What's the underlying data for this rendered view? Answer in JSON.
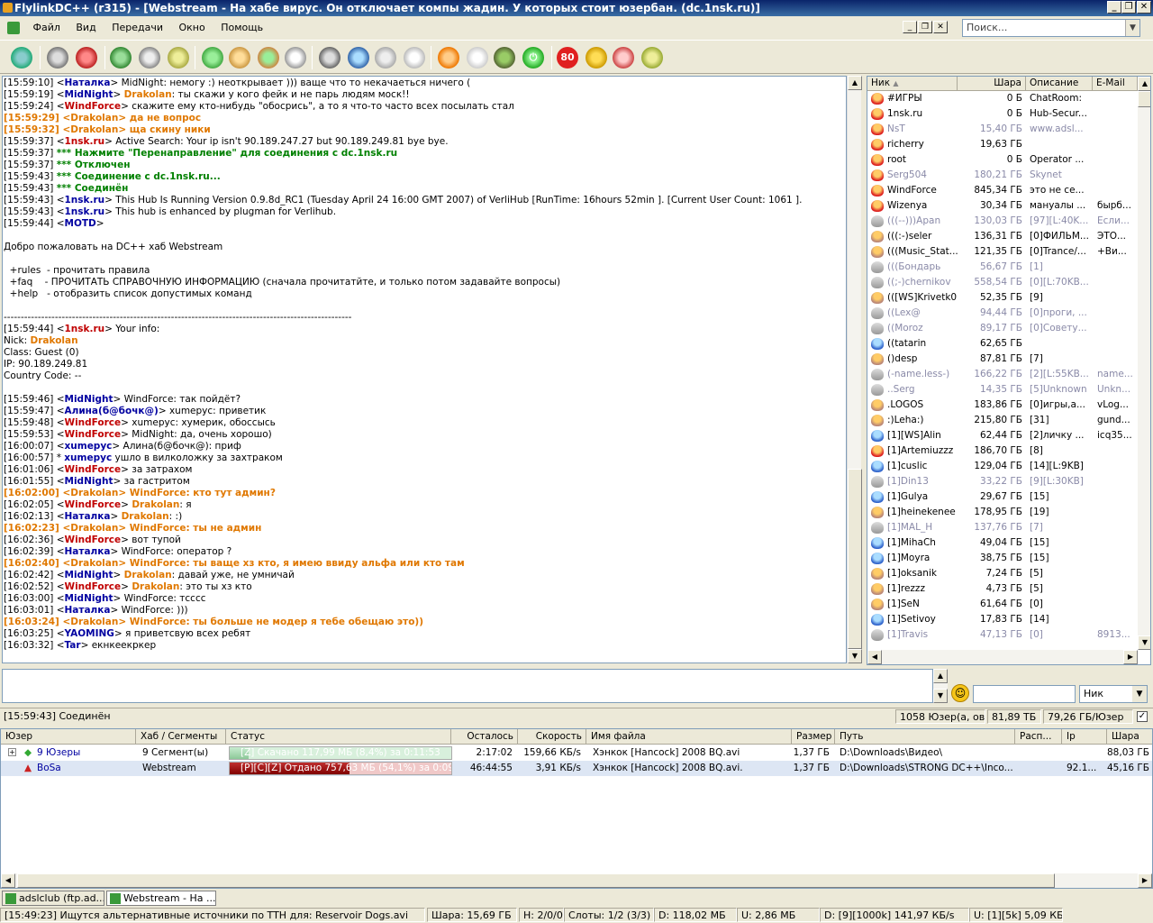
{
  "title": "FlylinkDC++ (r315) - [Webstream - На хабе вирус. Он отключает компы жадин. У которых стоит юзербан. (dc.1nsk.ru)]",
  "menu": [
    "Файл",
    "Вид",
    "Передачи",
    "Окно",
    "Помощь"
  ],
  "search_placeholder": "Поиск...",
  "toolbar_badge": "80",
  "chat": [
    [
      [
        "t",
        "[15:59:10] <"
      ],
      [
        "k",
        "Наталка"
      ],
      [
        "t",
        "> MidNight: немогу :) неоткрывает ))) ваще что то некачаеться ничего ("
      ]
    ],
    [
      [
        "t",
        "[15:59:19] <"
      ],
      [
        "k",
        "MidNight"
      ],
      [
        "t",
        "> "
      ],
      [
        "o",
        "Drakolan"
      ],
      [
        "t",
        ": ты скажи у кого фейк и не парь людям моск!!"
      ]
    ],
    [
      [
        "t",
        "[15:59:24] <"
      ],
      [
        "r",
        "WindForce"
      ],
      [
        "t",
        "> скажите ему кто-нибудь \"обосрись\", а то я что-то часто всех посылать стал"
      ]
    ],
    [
      [
        "m",
        "[15:59:29] <Drakolan> да не вопрос"
      ]
    ],
    [
      [
        "m",
        "[15:59:32] <Drakolan> ща скину ники"
      ]
    ],
    [
      [
        "t",
        "[15:59:37] <"
      ],
      [
        "r",
        "1nsk.ru"
      ],
      [
        "t",
        "> Active Search: Your ip isn't 90.189.247.27 but 90.189.249.81 bye bye."
      ]
    ],
    [
      [
        "t",
        "[15:59:37] "
      ],
      [
        "g",
        "*** Нажмите \"Перенаправление\" для соединения с dc.1nsk.ru"
      ]
    ],
    [
      [
        "t",
        "[15:59:37] "
      ],
      [
        "g",
        "*** Отключен"
      ]
    ],
    [
      [
        "t",
        "[15:59:43] "
      ],
      [
        "g",
        "*** Соединение с dc.1nsk.ru..."
      ]
    ],
    [
      [
        "t",
        "[15:59:43] "
      ],
      [
        "g",
        "*** Соединён"
      ]
    ],
    [
      [
        "t",
        "[15:59:43] <"
      ],
      [
        "k",
        "1nsk.ru"
      ],
      [
        "t",
        "> This Hub Is Running Version 0.9.8d_RC1 (Tuesday April 24 16:00 GMT 2007) of VerliHub [RunTime: 16hours 52min ]. [Current User Count: 1061 ]."
      ]
    ],
    [
      [
        "t",
        "[15:59:43] <"
      ],
      [
        "k",
        "1nsk.ru"
      ],
      [
        "t",
        "> This hub is enhanced by plugman for Verlihub."
      ]
    ],
    [
      [
        "t",
        "[15:59:44] <"
      ],
      [
        "k",
        "MOTD"
      ],
      [
        "t",
        ">"
      ]
    ],
    [
      [
        "t",
        ""
      ]
    ],
    [
      [
        "t",
        "Добро пожаловать на DC++ хаб Webstream"
      ]
    ],
    [
      [
        "t",
        ""
      ]
    ],
    [
      [
        "t",
        "  +rules  - прочитать правила"
      ]
    ],
    [
      [
        "t",
        "  +faq    - ПРОЧИТАТЬ СПРАВОЧНУЮ ИНФОРМАЦИЮ (сначала прочитатйте, и только потом задавайте вопросы)"
      ]
    ],
    [
      [
        "t",
        "  +help   - отобразить список допустимых команд"
      ]
    ],
    [
      [
        "t",
        ""
      ]
    ],
    [
      [
        "t",
        "------------------------------------------------------------------------------------------------------"
      ]
    ],
    [
      [
        "t",
        "[15:59:44] <"
      ],
      [
        "r",
        "1nsk.ru"
      ],
      [
        "t",
        "> Your info:"
      ]
    ],
    [
      [
        "t",
        "Nick: "
      ],
      [
        "o",
        "Drakolan"
      ]
    ],
    [
      [
        "t",
        "Class: Guest (0)"
      ]
    ],
    [
      [
        "t",
        "IP: 90.189.249.81"
      ]
    ],
    [
      [
        "t",
        "Country Code: --"
      ]
    ],
    [
      [
        "t",
        ""
      ]
    ],
    [
      [
        "t",
        "[15:59:46] <"
      ],
      [
        "k",
        "MidNight"
      ],
      [
        "t",
        "> WindForce: так пойдёт?"
      ]
    ],
    [
      [
        "t",
        "[15:59:47] <"
      ],
      [
        "k",
        "Алина(б@бочк@)"
      ],
      [
        "t",
        "> хumерус: приветик"
      ]
    ],
    [
      [
        "t",
        "[15:59:48] <"
      ],
      [
        "r",
        "WindForce"
      ],
      [
        "t",
        "> хumерус: хумерик, обоссысь"
      ]
    ],
    [
      [
        "t",
        "[15:59:53] <"
      ],
      [
        "r",
        "WindForce"
      ],
      [
        "t",
        "> MidNight: да, очень хорошо)"
      ]
    ],
    [
      [
        "t",
        "[16:00:07] <"
      ],
      [
        "k",
        "хumерус"
      ],
      [
        "t",
        "> Алина(б@бочк@): приф"
      ]
    ],
    [
      [
        "t",
        "[16:00:57] * "
      ],
      [
        "k",
        "хumерус"
      ],
      [
        "t",
        " ушло в вилколожку за захтраком"
      ]
    ],
    [
      [
        "t",
        "[16:01:06] <"
      ],
      [
        "r",
        "WindForce"
      ],
      [
        "t",
        "> за затрахом"
      ]
    ],
    [
      [
        "t",
        "[16:01:55] <"
      ],
      [
        "k",
        "MidNight"
      ],
      [
        "t",
        "> за гастритом"
      ]
    ],
    [
      [
        "m",
        "[16:02:00] <Drakolan> WindForce: кто тут админ?"
      ]
    ],
    [
      [
        "t",
        "[16:02:05] <"
      ],
      [
        "r",
        "WindForce"
      ],
      [
        "t",
        "> "
      ],
      [
        "o",
        "Drakolan"
      ],
      [
        "t",
        ": я"
      ]
    ],
    [
      [
        "t",
        "[16:02:13] <"
      ],
      [
        "k",
        "Наталка"
      ],
      [
        "t",
        "> "
      ],
      [
        "o",
        "Drakolan"
      ],
      [
        "t",
        ": :)"
      ]
    ],
    [
      [
        "m",
        "[16:02:23] <Drakolan> WindForce: ты не админ"
      ]
    ],
    [
      [
        "t",
        "[16:02:36] <"
      ],
      [
        "r",
        "WindForce"
      ],
      [
        "t",
        "> вот тупой"
      ]
    ],
    [
      [
        "t",
        "[16:02:39] <"
      ],
      [
        "k",
        "Наталка"
      ],
      [
        "t",
        "> WindForce: оператор ?"
      ]
    ],
    [
      [
        "m",
        "[16:02:40] <Drakolan> WindForce: ты ваще хз кто, я имею ввиду альфа или кто там"
      ]
    ],
    [
      [
        "t",
        "[16:02:42] <"
      ],
      [
        "k",
        "MidNight"
      ],
      [
        "t",
        "> "
      ],
      [
        "o",
        "Drakolan"
      ],
      [
        "t",
        ": давай уже, не умничай"
      ]
    ],
    [
      [
        "t",
        "[16:02:52] <"
      ],
      [
        "r",
        "WindForce"
      ],
      [
        "t",
        "> "
      ],
      [
        "o",
        "Drakolan"
      ],
      [
        "t",
        ": это ты хз кто"
      ]
    ],
    [
      [
        "t",
        "[16:03:00] <"
      ],
      [
        "k",
        "MidNight"
      ],
      [
        "t",
        "> WindForce: тсссс"
      ]
    ],
    [
      [
        "t",
        "[16:03:01] <"
      ],
      [
        "k",
        "Наталка"
      ],
      [
        "t",
        "> WindForce: )))"
      ]
    ],
    [
      [
        "m",
        "[16:03:24] <Drakolan> WindForce: ты больше не модер я тебе обещаю это))"
      ]
    ],
    [
      [
        "t",
        "[16:03:25] <"
      ],
      [
        "k",
        "YAOMING"
      ],
      [
        "t",
        "> я приветсвую всех ребят"
      ]
    ],
    [
      [
        "t",
        "[16:03:32] <"
      ],
      [
        "k",
        "Tar"
      ],
      [
        "t",
        "> екнкеекркер"
      ]
    ]
  ],
  "users_header": {
    "nick": "Ник",
    "share": "Шара",
    "desc": "Описание",
    "email": "E-Mail"
  },
  "users": [
    {
      "nick": "#ИГРЫ",
      "share": "0 Б",
      "desc": "ChatRoom:",
      "email": "",
      "grey": false,
      "icon": "op"
    },
    {
      "nick": "1nsk.ru",
      "share": "0 Б",
      "desc": "Hub-Secur...",
      "email": "",
      "grey": false,
      "icon": "op"
    },
    {
      "nick": "NsT",
      "share": "15,40 ГБ",
      "desc": "www.adsl...",
      "email": "",
      "grey": true,
      "icon": "op"
    },
    {
      "nick": "richerry",
      "share": "19,63 ГБ",
      "desc": "",
      "email": "",
      "grey": false,
      "icon": "op"
    },
    {
      "nick": "root",
      "share": "0 Б",
      "desc": "Operator ...",
      "email": "",
      "grey": false,
      "icon": "op"
    },
    {
      "nick": "Serg504",
      "share": "180,21 ГБ",
      "desc": "Skynet",
      "email": "",
      "grey": true,
      "icon": "op"
    },
    {
      "nick": "WindForce",
      "share": "845,34 ГБ",
      "desc": "это не се...",
      "email": "",
      "grey": false,
      "icon": "op"
    },
    {
      "nick": "Wizenya",
      "share": "30,34 ГБ",
      "desc": "мануалы ...",
      "email": "бырб...",
      "grey": false,
      "icon": "op"
    },
    {
      "nick": "(((--)))Apan",
      "share": "130,03 ГБ",
      "desc": "[97][L:40K...",
      "email": "Если...",
      "grey": true,
      "icon": "pas"
    },
    {
      "nick": "(((:-)seler",
      "share": "136,31 ГБ",
      "desc": "[0]ФИЛЬМ...",
      "email": "ЭТО...",
      "grey": false,
      "icon": "usr"
    },
    {
      "nick": "(((Music_Stat...",
      "share": "121,35 ГБ",
      "desc": "[0]Trance/...",
      "email": "+Ви...",
      "grey": false,
      "icon": "usr"
    },
    {
      "nick": "(((Бондарь",
      "share": "56,67 ГБ",
      "desc": "[1]",
      "email": "",
      "grey": true,
      "icon": "pas"
    },
    {
      "nick": "((;-)chernikov",
      "share": "558,54 ГБ",
      "desc": "[0][L:70KB...",
      "email": "",
      "grey": true,
      "icon": "pas"
    },
    {
      "nick": "(([WS]Krivetk0",
      "share": "52,35 ГБ",
      "desc": "[9]",
      "email": "",
      "grey": false,
      "icon": "usr"
    },
    {
      "nick": "((Lex@",
      "share": "94,44 ГБ",
      "desc": "[0]проги, ...",
      "email": "",
      "grey": true,
      "icon": "pas"
    },
    {
      "nick": "((Moroz",
      "share": "89,17 ГБ",
      "desc": "[0]Совету...",
      "email": "",
      "grey": true,
      "icon": "pas"
    },
    {
      "nick": "((tatarin",
      "share": "62,65 ГБ",
      "desc": "",
      "email": "",
      "grey": false,
      "icon": "net"
    },
    {
      "nick": "()desp",
      "share": "87,81 ГБ",
      "desc": "[7]",
      "email": "",
      "grey": false,
      "icon": "usr"
    },
    {
      "nick": "(-name.less-)",
      "share": "166,22 ГБ",
      "desc": "[2][L:55KB...",
      "email": "name...",
      "grey": true,
      "icon": "pas"
    },
    {
      "nick": "..Serg",
      "share": "14,35 ГБ",
      "desc": "[5]Unknown",
      "email": "Unkn...",
      "grey": true,
      "icon": "pas"
    },
    {
      "nick": ".LOGOS",
      "share": "183,86 ГБ",
      "desc": "[0]игры,а...",
      "email": "vLog...",
      "grey": false,
      "icon": "usr"
    },
    {
      "nick": ":)Leha:)",
      "share": "215,80 ГБ",
      "desc": "[31]",
      "email": "gund...",
      "grey": false,
      "icon": "usr"
    },
    {
      "nick": "[1][WS]Alin",
      "share": "62,44 ГБ",
      "desc": "[2]личку ...",
      "email": "icq35...",
      "grey": false,
      "icon": "net"
    },
    {
      "nick": "[1]Artemiuzzz",
      "share": "186,70 ГБ",
      "desc": "[8]",
      "email": "",
      "grey": false,
      "icon": "op"
    },
    {
      "nick": "[1]cuslic",
      "share": "129,04 ГБ",
      "desc": "[14][L:9KB]",
      "email": "",
      "grey": false,
      "icon": "net"
    },
    {
      "nick": "[1]Din13",
      "share": "33,22 ГБ",
      "desc": "[9][L:30KB]",
      "email": "",
      "grey": true,
      "icon": "pas"
    },
    {
      "nick": "[1]Gulya",
      "share": "29,67 ГБ",
      "desc": "[15]",
      "email": "",
      "grey": false,
      "icon": "net"
    },
    {
      "nick": "[1]heinekenee",
      "share": "178,95 ГБ",
      "desc": "[19]",
      "email": "",
      "grey": false,
      "icon": "usr"
    },
    {
      "nick": "[1]MAL_H",
      "share": "137,76 ГБ",
      "desc": "[7]",
      "email": "",
      "grey": true,
      "icon": "pas"
    },
    {
      "nick": "[1]MihaCh",
      "share": "49,04 ГБ",
      "desc": "[15]",
      "email": "",
      "grey": false,
      "icon": "net"
    },
    {
      "nick": "[1]Moyra",
      "share": "38,75 ГБ",
      "desc": "[15]",
      "email": "",
      "grey": false,
      "icon": "net"
    },
    {
      "nick": "[1]oksanik",
      "share": "7,24 ГБ",
      "desc": "[5]",
      "email": "",
      "grey": false,
      "icon": "usr"
    },
    {
      "nick": "[1]rezzz",
      "share": "4,73 ГБ",
      "desc": "[5]",
      "email": "",
      "grey": false,
      "icon": "usr"
    },
    {
      "nick": "[1]SeN",
      "share": "61,64 ГБ",
      "desc": "[0]",
      "email": "",
      "grey": false,
      "icon": "usr"
    },
    {
      "nick": "[1]Setivoy",
      "share": "17,83 ГБ",
      "desc": "[14]",
      "email": "",
      "grey": false,
      "icon": "net"
    },
    {
      "nick": "[1]Travis",
      "share": "47,13 ГБ",
      "desc": "[0]",
      "email": "8913...",
      "grey": true,
      "icon": "pas"
    }
  ],
  "hub_status": {
    "msg": "[15:59:43] Соединён",
    "users": "1058 Юзер(а, ов)",
    "total_share": "81,89 ТБ",
    "per_user": "79,26 ГБ/Юзер"
  },
  "nick_select": "Ник",
  "transfers_header": [
    "Юзер",
    "Хаб / Сегменты",
    "Статус",
    "Осталось",
    "Скорость",
    "Имя файла",
    "Размер",
    "Путь",
    "Расп...",
    "Ip",
    "Шара"
  ],
  "transfers": [
    {
      "user": "9 Юзеры",
      "hub": "9 Сегмент(ы)",
      "status": "[Z] Скачано 117,99 МБ (8,4%) за 0:11:53",
      "progress": 8.4,
      "left": "2:17:02",
      "speed": "159,66 КБ/s",
      "file": "Хэнкок [Hancock] 2008 BQ.avi",
      "size": "1,37 ГБ",
      "path": "D:\\Downloads\\Видео\\",
      "dist": "",
      "ip": "",
      "share": "88,03 ГБ",
      "kind": "down"
    },
    {
      "user": "BoSa",
      "hub": "Webstream",
      "status": "[P][C][Z] Отдано 757,63 МБ (54,1%) за 0:09:1",
      "progress": 54.1,
      "left": "46:44:55",
      "speed": "3,91 КБ/s",
      "file": "Хэнкок [Hancock] 2008 BQ.avi...",
      "size": "1,37 ГБ",
      "path": "D:\\Downloads\\STRONG DC++\\Inco...",
      "dist": "",
      "ip": "92.1...",
      "share": "45,16 ГБ",
      "kind": "up"
    }
  ],
  "tabs": [
    "adslclub (ftp.ad...",
    "Webstream - На ..."
  ],
  "statusbar": {
    "msg": "[15:49:23] Ищутся альтернативные источники по TTH для: Reservoir Dogs.avi",
    "share": "Шара: 15,69 ГБ",
    "hubs": "H: 2/0/0",
    "slots": "Слоты: 1/2 (3/3)",
    "down": "D: 118,02 МБ",
    "up": "U: 2,86 МБ",
    "dspeed": "D: [9][1000k] 141,97 КБ/s",
    "uspeed": "U: [1][5k] 5,09 КБ/s"
  },
  "colors": {
    "titlebar": "#0a246a",
    "op_nick": "#c00000",
    "reg_nick": "#0000a0",
    "own_nick": "#e07800",
    "system": "#008000",
    "progress_down": "#a8dcb0",
    "progress_up": "#a00000"
  }
}
